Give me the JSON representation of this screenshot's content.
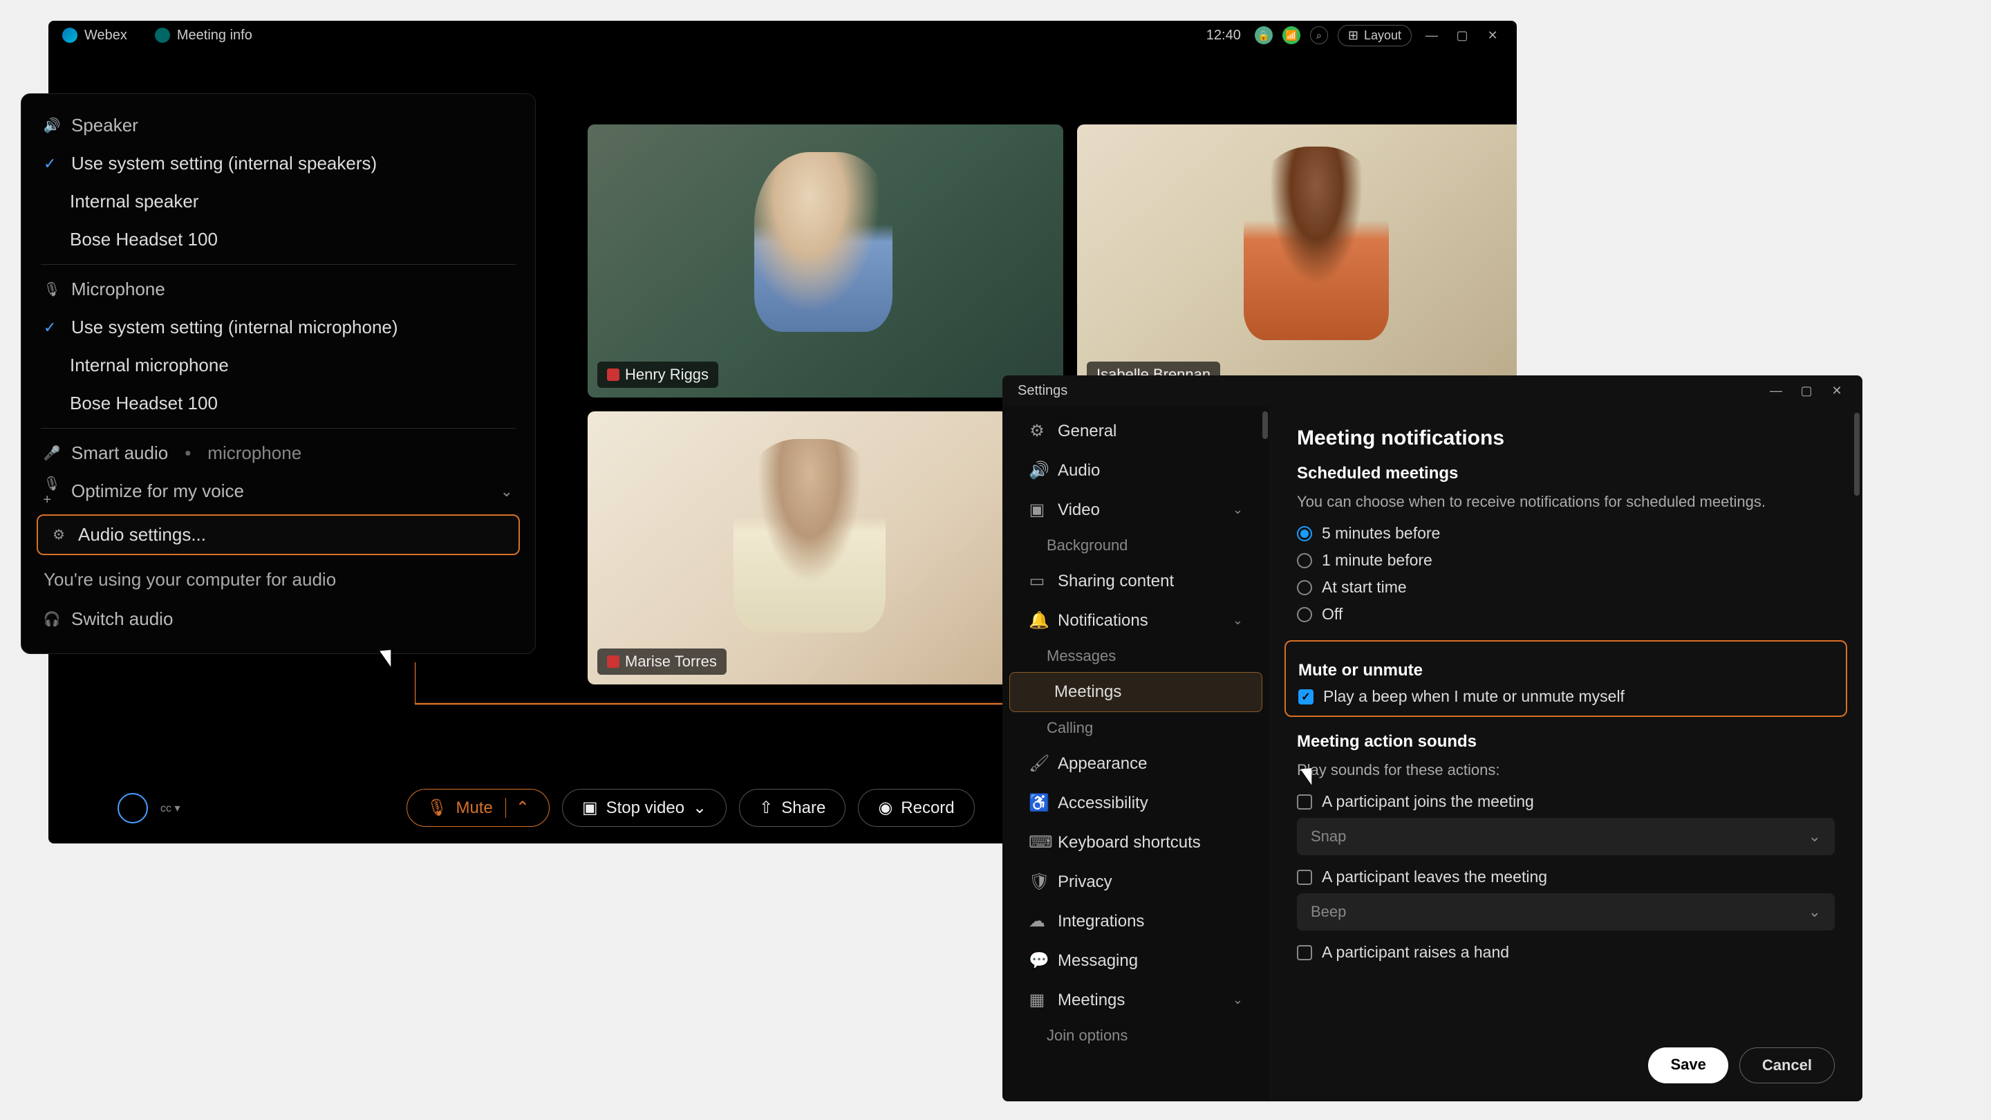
{
  "app": {
    "name": "Webex",
    "meeting_info": "Meeting info",
    "time": "12:40",
    "layout": "Layout"
  },
  "video": {
    "participants": [
      {
        "name": "Henry Riggs"
      },
      {
        "name": "Isabelle Brennan"
      },
      {
        "name": "Marise Torres"
      }
    ]
  },
  "audio_menu": {
    "speaker_header": "Speaker",
    "speaker_items": [
      "Use system setting (internal speakers)",
      "Internal speaker",
      "Bose Headset 100"
    ],
    "mic_header": "Microphone",
    "mic_items": [
      "Use system setting (internal microphone)",
      "Internal microphone",
      "Bose Headset 100"
    ],
    "smart_audio": "Smart audio",
    "smart_audio_suffix": "microphone",
    "optimize": "Optimize for my voice",
    "audio_settings": "Audio settings...",
    "using_text": "You're using your computer for audio",
    "switch": "Switch audio"
  },
  "controls": {
    "mute": "Mute",
    "stop_video": "Stop video",
    "share": "Share",
    "record": "Record"
  },
  "settings": {
    "title": "Settings",
    "sidebar": {
      "items": [
        "General",
        "Audio",
        "Video",
        "Background",
        "Sharing content",
        "Notifications",
        "Messages",
        "Meetings",
        "Calling",
        "Appearance",
        "Accessibility",
        "Keyboard shortcuts",
        "Privacy",
        "Integrations",
        "Messaging",
        "Meetings",
        "Join options"
      ]
    },
    "content": {
      "heading": "Meeting notifications",
      "scheduled_heading": "Scheduled meetings",
      "scheduled_desc": "You can choose when to receive notifications for scheduled meetings.",
      "radio_options": [
        "5 minutes before",
        "1 minute before",
        "At start time",
        "Off"
      ],
      "mute_heading": "Mute or unmute",
      "mute_checkbox": "Play a beep when I mute or unmute myself",
      "actions_heading": "Meeting action sounds",
      "actions_desc": "Play sounds for these actions:",
      "action_items": [
        {
          "label": "A participant joins the meeting",
          "sound": "Snap"
        },
        {
          "label": "A participant leaves the meeting",
          "sound": "Beep"
        },
        {
          "label": "A participant raises a hand"
        }
      ],
      "save": "Save",
      "cancel": "Cancel"
    }
  }
}
